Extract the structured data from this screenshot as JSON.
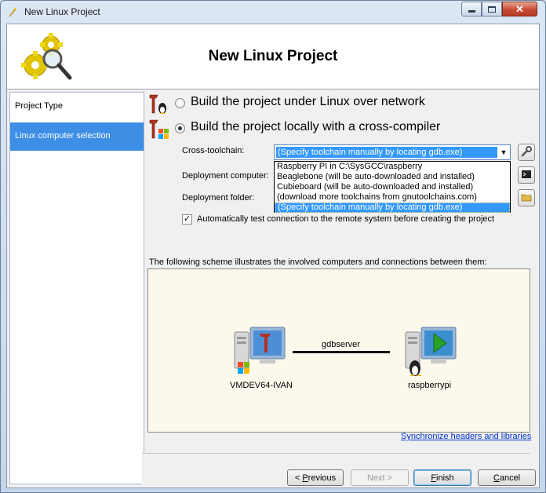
{
  "window": {
    "title": "New Linux Project"
  },
  "header": {
    "title": "New Linux Project"
  },
  "nav": {
    "items": [
      {
        "label": "Project Type",
        "selected": false
      },
      {
        "label": "Linux computer selection",
        "selected": true
      }
    ]
  },
  "options": {
    "network": {
      "label": "Build the project under Linux over network",
      "checked": false
    },
    "local": {
      "label": "Build the project locally with a cross-compiler",
      "checked": true
    }
  },
  "form": {
    "toolchain_label": "Cross-toolchain:",
    "toolchain_value": "(Specify toolchain manually by locating gdb.exe)",
    "deployment_computer_label": "Deployment computer:",
    "deployment_folder_label": "Deployment folder:",
    "auto_test_label": "Automatically test connection to the remote system before creating the project",
    "auto_test_checked": true
  },
  "toolchain_options": [
    "Raspberry PI in C:\\SysGCC\\raspberry",
    "Beaglebone (will be auto-downloaded and installed)",
    "Cubieboard (will be auto-downloaded and installed)",
    "(download more toolchains from gnutoolchains.com)",
    "(Specify toolchain manually by locating gdb.exe)"
  ],
  "toolchain_selected_index": 4,
  "scheme": {
    "caption": "The following scheme illustrates the involved computers and connections between them:",
    "local_computer": "VMDEV64-IVAN",
    "remote_computer": "raspberrypi",
    "connection_label": "gdbserver"
  },
  "sync_link": "Synchronize headers and libraries",
  "buttons": {
    "previous": {
      "prefix": "< ",
      "mnemonic": "P",
      "rest": "revious"
    },
    "next": "Next >",
    "finish": {
      "mnemonic": "F",
      "rest": "inish"
    },
    "cancel": {
      "mnemonic": "C",
      "rest": "ancel"
    }
  },
  "colors": {
    "nav_selected": "#3d8ee5",
    "selection_highlight": "#3399ff",
    "link": "#0033cc",
    "scheme_bg": "#fcf8ec"
  }
}
